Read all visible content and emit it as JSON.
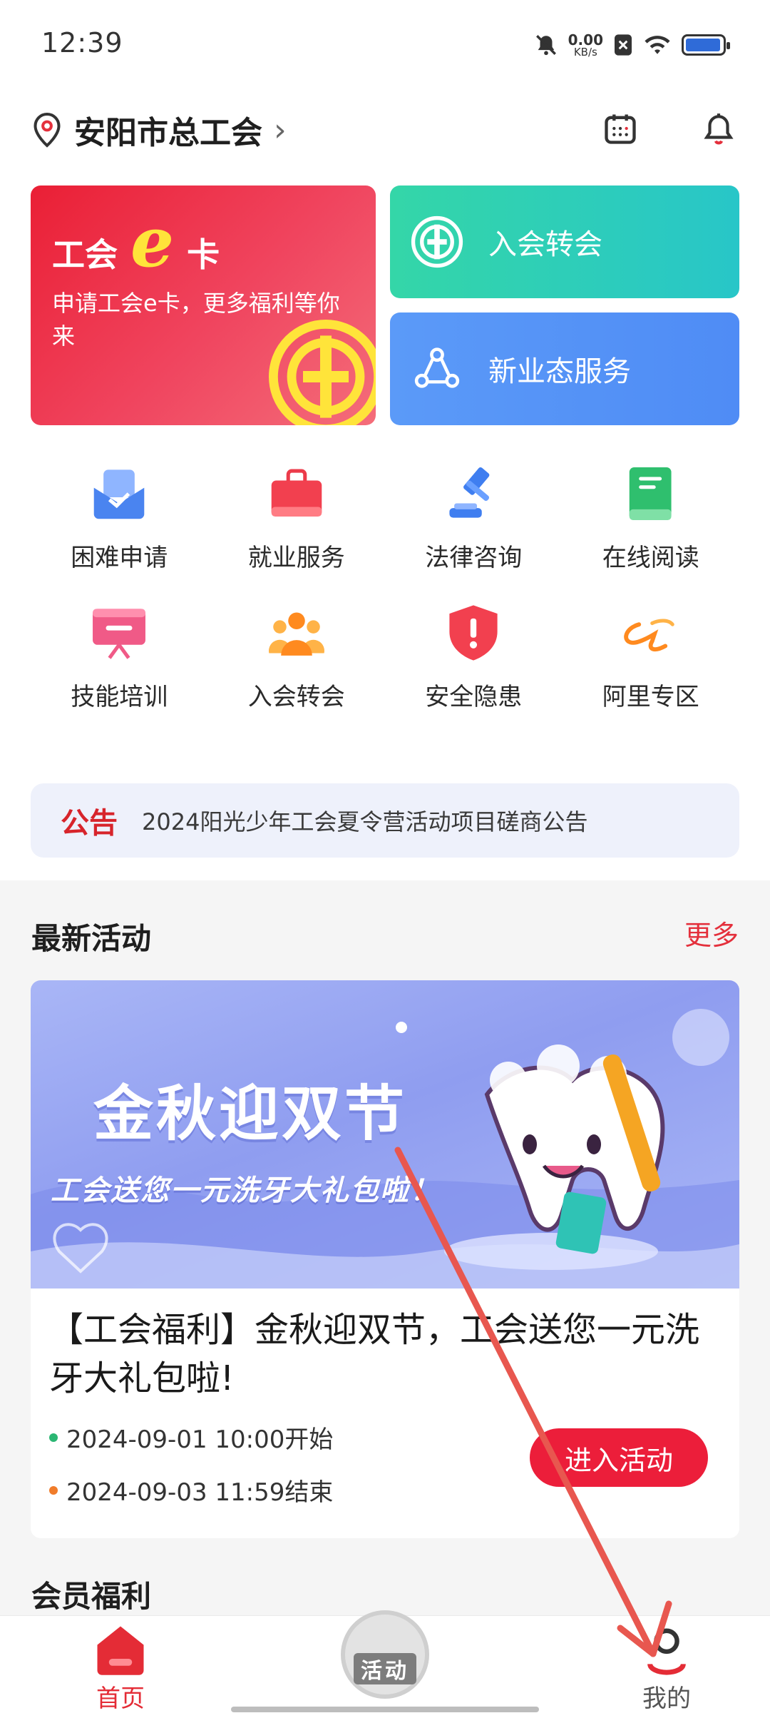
{
  "status_bar": {
    "time": "12:39",
    "net_speed_value": "0.00",
    "net_speed_unit": "KB/s",
    "battery_level": 0.95,
    "battery_color": "#2f6bd8"
  },
  "header": {
    "location": "安阳市总工会",
    "icons": [
      "location-pin-icon",
      "calendar-icon",
      "bell-icon"
    ]
  },
  "hero": {
    "ecard": {
      "title_left": "工会",
      "title_e": "e",
      "title_right": "卡",
      "subtitle": "申请工会e卡，更多福利等你来"
    },
    "join_transfer": {
      "label": "入会转会"
    },
    "new_business": {
      "label": "新业态服务"
    }
  },
  "grid": {
    "items": [
      {
        "label": "困难申请",
        "icon": "envelope-icon"
      },
      {
        "label": "就业服务",
        "icon": "briefcase-icon"
      },
      {
        "label": "法律咨询",
        "icon": "gavel-icon"
      },
      {
        "label": "在线阅读",
        "icon": "book-icon"
      },
      {
        "label": "技能培训",
        "icon": "whiteboard-icon"
      },
      {
        "label": "入会转会",
        "icon": "people-icon"
      },
      {
        "label": "安全隐患",
        "icon": "shield-alert-icon"
      },
      {
        "label": "阿里专区",
        "icon": "alibaba-logo-icon"
      }
    ]
  },
  "notice": {
    "tag": "公告",
    "text": "2024阳光少年工会夏令营活动项目磋商公告"
  },
  "activities": {
    "title": "最新活动",
    "more": "更多",
    "card": {
      "banner_title": "金秋迎双节",
      "banner_subtitle": "工会送您一元洗牙大礼包啦！",
      "title": "【工会福利】金秋迎双节，工会送您一元洗牙大礼包啦!",
      "start": "2024-09-01 10:00开始",
      "end": "2024-09-03 11:59结束",
      "button": "进入活动",
      "start_dot_color": "#2bb673",
      "end_dot_color": "#f07c2a"
    }
  },
  "member_benefits": {
    "title": "会员福利"
  },
  "bottom_nav": {
    "home": "首页",
    "activity": "活动",
    "mine": "我的",
    "accent": "#e42c36"
  }
}
